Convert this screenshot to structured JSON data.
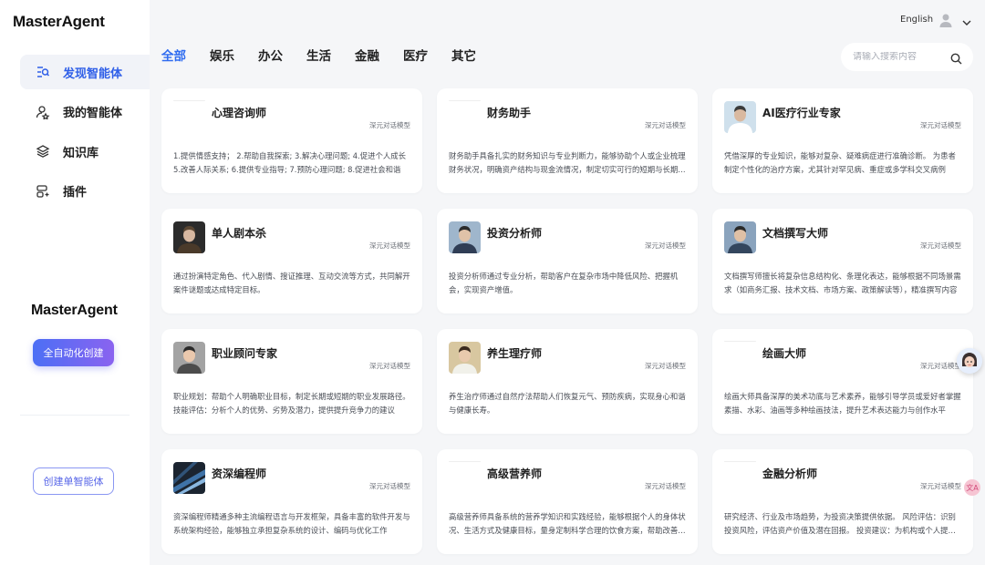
{
  "brand": {
    "name": "MasterAgent"
  },
  "sidebar": {
    "items": [
      {
        "label": "发现智能体",
        "icon": "discover-search-icon",
        "active": true
      },
      {
        "label": "我的智能体",
        "icon": "user-agent-icon",
        "active": false
      },
      {
        "label": "知识库",
        "icon": "layers-icon",
        "active": false
      },
      {
        "label": "插件",
        "icon": "plugin-icon",
        "active": false
      }
    ],
    "promo_logo": "MasterAgent",
    "auto_create_label": "全自动化创建",
    "create_single_label": "创建单智能体"
  },
  "header": {
    "language": "English",
    "account_icon": "user-avatar-icon",
    "menu_icon": "chevron-down-icon"
  },
  "tabs": [
    {
      "label": "全部",
      "active": true
    },
    {
      "label": "娱乐",
      "active": false
    },
    {
      "label": "办公",
      "active": false
    },
    {
      "label": "生活",
      "active": false
    },
    {
      "label": "金融",
      "active": false
    },
    {
      "label": "医疗",
      "active": false
    },
    {
      "label": "其它",
      "active": false
    }
  ],
  "search": {
    "placeholder": "请输入搜索内容",
    "value": ""
  },
  "cards": [
    {
      "name": "心理咨询师",
      "model": "深元对话模型",
      "has_image": false,
      "desc": "1.提供情感支持； 2.帮助自我探索; 3.解决心理问题; 4.促进个人成长 5.改善人际关系; 6.提供专业指导; 7.预防心理问题; 8.促进社会和谐"
    },
    {
      "name": "财务助手",
      "model": "深元对话模型",
      "has_image": false,
      "desc": "财务助手具备扎实的财务知识与专业判断力，能够协助个人或企业梳理财务状况，明确资产结构与现金流情况，制定切实可行的短期与长期财务规划"
    },
    {
      "name": "AI医疗行业专家",
      "model": "深元对话模型",
      "has_image": true,
      "desc": "凭借深厚的专业知识，能够对复杂、疑难病症进行准确诊断。 为患者制定个性化的治疗方案，尤其针对罕见病、重症或多学科交叉病例"
    },
    {
      "name": "单人剧本杀",
      "model": "深元对话模型",
      "has_image": true,
      "desc": "通过扮演特定角色、代入剧情、搜证推理、互动交流等方式，共同解开案件谜题或达成特定目标。"
    },
    {
      "name": "投资分析师",
      "model": "深元对话模型",
      "has_image": true,
      "desc": "投资分析师通过专业分析，帮助客户在复杂市场中降低风险、把握机会，实现资产增值。"
    },
    {
      "name": "文档撰写大师",
      "model": "深元对话模型",
      "has_image": true,
      "desc": "文档撰写师擅长将复杂信息结构化、条理化表达，能够根据不同场景需求（如商务汇报、技术文档、市场方案、政策解读等），精准撰写内容"
    },
    {
      "name": "职业顾问专家",
      "model": "深元对话模型",
      "has_image": true,
      "desc": "职业规划：帮助个人明确职业目标，制定长期或短期的职业发展路径。 技能评估：分析个人的优势、劣势及潜力，提供提升竞争力的建议"
    },
    {
      "name": "养生理疗师",
      "model": "深元对话模型",
      "has_image": true,
      "desc": "养生治疗师通过自然疗法帮助人们恢复元气、预防疾病，实现身心和谐与健康长寿。"
    },
    {
      "name": "绘画大师",
      "model": "深元对话模型",
      "has_image": false,
      "desc": "绘画大师具备深厚的美术功底与艺术素养，能够引导学员或爱好者掌握素描、水彩、油画等多种绘画技法，提升艺术表达能力与创作水平"
    },
    {
      "name": "资深编程师",
      "model": "深元对话模型",
      "has_image": true,
      "desc": "资深编程师精通多种主流编程语言与开发框架，具备丰富的软件开发与系统架构经验，能够独立承担复杂系统的设计、编码与优化工作"
    },
    {
      "name": "高级营养师",
      "model": "深元对话模型",
      "has_image": false,
      "desc": "高级营养师具备系统的营养学知识和实践经验，能够根据个人的身体状况、生活方式及健康目标，量身定制科学合理的饮食方案，帮助改善健康"
    },
    {
      "name": "金融分析师",
      "model": "深元对话模型",
      "has_image": false,
      "desc": "研究经济、行业及市场趋势，为投资决策提供依据。 风险评估：识别投资风险，评估资产价值及潜在回报。 投资建议：为机构或个人提供投资建议"
    }
  ],
  "floating": {
    "assistant_icon": "assistant-avatar-icon",
    "translate_icon": "translate-icon",
    "translate_glyph": "文A"
  }
}
